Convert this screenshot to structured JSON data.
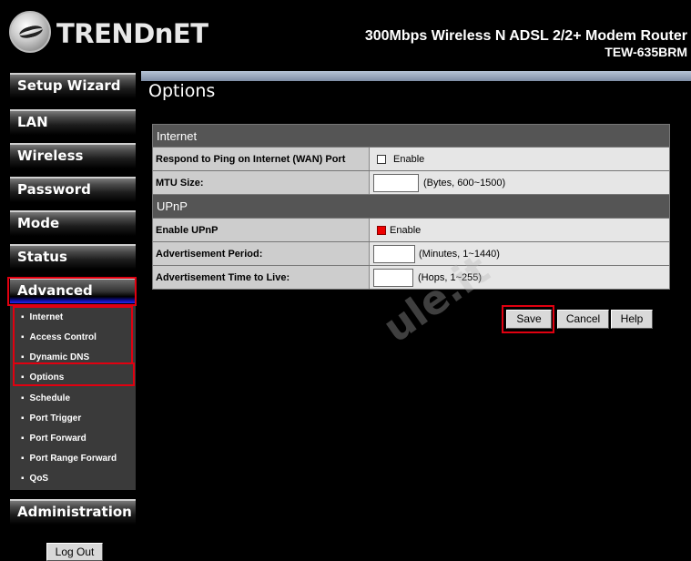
{
  "header": {
    "brand": "TRENDnET",
    "product_title": "300Mbps Wireless N ADSL 2/2+ Modem Router",
    "product_model": "TEW-635BRM"
  },
  "sidebar": {
    "items": [
      {
        "label": "Setup Wizard"
      },
      {
        "label": "LAN"
      },
      {
        "label": "Wireless"
      },
      {
        "label": "Password"
      },
      {
        "label": "Mode"
      },
      {
        "label": "Status"
      },
      {
        "label": "Advanced"
      },
      {
        "label": "Administration"
      }
    ],
    "submenu": [
      {
        "label": "Internet"
      },
      {
        "label": "Access Control"
      },
      {
        "label": "Dynamic DNS"
      },
      {
        "label": "Options"
      },
      {
        "label": "Schedule"
      },
      {
        "label": "Port Trigger"
      },
      {
        "label": "Port Forward"
      },
      {
        "label": "Port Range Forward"
      },
      {
        "label": "QoS"
      }
    ],
    "logout_label": "Log Out",
    "bullet": "▪"
  },
  "content": {
    "page_title": "Options",
    "internet": {
      "heading": "Internet",
      "ping_label": "Respond to Ping on Internet (WAN) Port",
      "ping_enable_label": "Enable",
      "mtu_label": "MTU Size:",
      "mtu_value": "",
      "mtu_hint": "(Bytes, 600~1500)"
    },
    "upnp": {
      "heading": "UPnP",
      "enable_label": "Enable UPnP",
      "enable_text": "Enable",
      "adv_period_label": "Advertisement Period:",
      "adv_period_value": "",
      "adv_period_hint": "(Minutes, 1~1440)",
      "adv_ttl_label": "Advertisement Time to Live:",
      "adv_ttl_value": "",
      "adv_ttl_hint": "(Hops, 1~255)"
    },
    "buttons": {
      "save": "Save",
      "cancel": "Cancel",
      "help": "Help"
    },
    "watermark": "ule.it"
  },
  "colors": {
    "highlight_red": "#e00010",
    "active_blue": "#2a2aee"
  }
}
